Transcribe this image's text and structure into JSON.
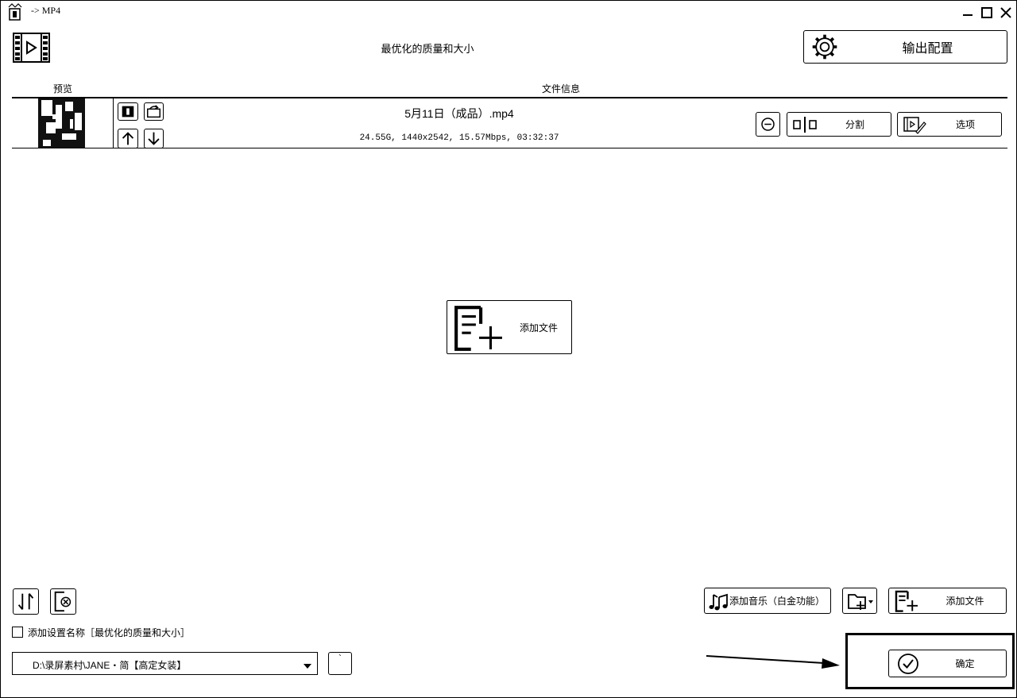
{
  "window": {
    "title": "-> MP4"
  },
  "header": {
    "profile": "最优化的质量和大小",
    "output_config_label": "输出配置"
  },
  "file_list": {
    "columns": [
      "预览",
      "文件信息"
    ],
    "files": [
      {
        "name": "5月11日（成品）.mp4",
        "info": "24.55G, 1440x2542, 15.57Mbps, 03:32:37"
      }
    ]
  },
  "row_buttons": {
    "split_label": "分割",
    "options_label": "选项"
  },
  "center_add": {
    "label": "添加文件"
  },
  "toolbar": {
    "add_music_label": "添加音乐（白金功能）",
    "add_file_label": "添加文件"
  },
  "settings": {
    "add_setting_name_label": "添加设置名称［最优化的质量和大小］",
    "checked": false
  },
  "output": {
    "path": "D:\\录屏素村\\JANE・简【高定女装】",
    "browse_label": "`"
  },
  "confirm": {
    "label": "确定"
  }
}
